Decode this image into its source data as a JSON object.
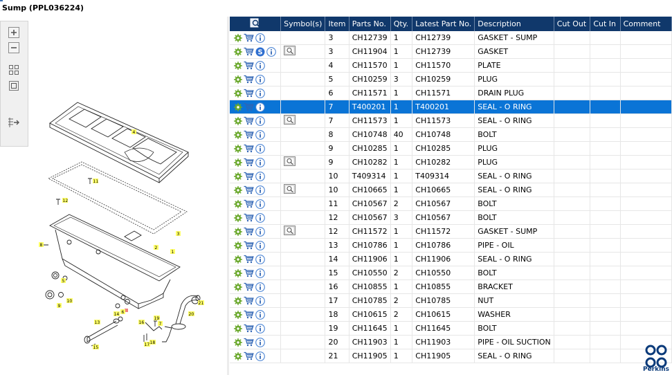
{
  "window": {
    "title": "Sump (PPL036224)"
  },
  "brand": {
    "name": "Perkins",
    "color": "#0a3a7a",
    "header_bg": "#10386b",
    "selected_bg": "#0a74d6"
  },
  "toolbar": {
    "buttons": [
      {
        "icon": "zoom-in-icon"
      },
      {
        "icon": "zoom-out-icon"
      },
      {
        "icon": "fit-all-icon"
      },
      {
        "icon": "fit-window-icon"
      },
      {
        "icon": "export-icon"
      }
    ]
  },
  "drawing": {
    "callouts": [
      "4",
      "11",
      "12",
      "2",
      "3",
      "1",
      "8",
      "5",
      "6",
      "9",
      "10",
      "14",
      "13",
      "16",
      "19",
      "7",
      "17",
      "18",
      "15",
      "20",
      "21"
    ]
  },
  "table": {
    "columns": [
      "",
      "Symbol(s)",
      "Item",
      "Parts No.",
      "Qty.",
      "Latest Part No.",
      "Description",
      "Cut Out",
      "Cut In",
      "Comment"
    ],
    "rows": [
      {
        "item": "3",
        "part": "CH12739",
        "qty": "1",
        "latest": "CH12739",
        "desc": "GASKET - SUMP",
        "s_icon": false,
        "sym": false,
        "selected": false
      },
      {
        "item": "3",
        "part": "CH11904",
        "qty": "1",
        "latest": "CH12739",
        "desc": "GASKET",
        "s_icon": true,
        "sym": true,
        "selected": false
      },
      {
        "item": "4",
        "part": "CH11570",
        "qty": "1",
        "latest": "CH11570",
        "desc": "PLATE",
        "s_icon": false,
        "sym": false,
        "selected": false
      },
      {
        "item": "5",
        "part": "CH10259",
        "qty": "3",
        "latest": "CH10259",
        "desc": "PLUG",
        "s_icon": false,
        "sym": false,
        "selected": false
      },
      {
        "item": "6",
        "part": "CH11571",
        "qty": "1",
        "latest": "CH11571",
        "desc": "DRAIN PLUG",
        "s_icon": false,
        "sym": false,
        "selected": false
      },
      {
        "item": "7",
        "part": "T400201",
        "qty": "1",
        "latest": "T400201",
        "desc": "SEAL - O RING",
        "s_icon": false,
        "sym": false,
        "selected": true
      },
      {
        "item": "7",
        "part": "CH11573",
        "qty": "1",
        "latest": "CH11573",
        "desc": "SEAL - O RING",
        "s_icon": false,
        "sym": true,
        "selected": false
      },
      {
        "item": "8",
        "part": "CH10748",
        "qty": "40",
        "latest": "CH10748",
        "desc": "BOLT",
        "s_icon": false,
        "sym": false,
        "selected": false
      },
      {
        "item": "9",
        "part": "CH10285",
        "qty": "1",
        "latest": "CH10285",
        "desc": "PLUG",
        "s_icon": false,
        "sym": false,
        "selected": false
      },
      {
        "item": "9",
        "part": "CH10282",
        "qty": "1",
        "latest": "CH10282",
        "desc": "PLUG",
        "s_icon": false,
        "sym": true,
        "selected": false
      },
      {
        "item": "10",
        "part": "T409314",
        "qty": "1",
        "latest": "T409314",
        "desc": "SEAL - O RING",
        "s_icon": false,
        "sym": false,
        "selected": false
      },
      {
        "item": "10",
        "part": "CH10665",
        "qty": "1",
        "latest": "CH10665",
        "desc": "SEAL - O RING",
        "s_icon": false,
        "sym": true,
        "selected": false
      },
      {
        "item": "11",
        "part": "CH10567",
        "qty": "2",
        "latest": "CH10567",
        "desc": "BOLT",
        "s_icon": false,
        "sym": false,
        "selected": false
      },
      {
        "item": "12",
        "part": "CH10567",
        "qty": "3",
        "latest": "CH10567",
        "desc": "BOLT",
        "s_icon": false,
        "sym": false,
        "selected": false
      },
      {
        "item": "12",
        "part": "CH11572",
        "qty": "1",
        "latest": "CH11572",
        "desc": "GASKET - SUMP",
        "s_icon": false,
        "sym": true,
        "selected": false
      },
      {
        "item": "13",
        "part": "CH10786",
        "qty": "1",
        "latest": "CH10786",
        "desc": "PIPE - OIL",
        "s_icon": false,
        "sym": false,
        "selected": false
      },
      {
        "item": "14",
        "part": "CH11906",
        "qty": "1",
        "latest": "CH11906",
        "desc": "SEAL - O RING",
        "s_icon": false,
        "sym": false,
        "selected": false
      },
      {
        "item": "15",
        "part": "CH10550",
        "qty": "2",
        "latest": "CH10550",
        "desc": "BOLT",
        "s_icon": false,
        "sym": false,
        "selected": false
      },
      {
        "item": "16",
        "part": "CH10855",
        "qty": "1",
        "latest": "CH10855",
        "desc": "BRACKET",
        "s_icon": false,
        "sym": false,
        "selected": false
      },
      {
        "item": "17",
        "part": "CH10785",
        "qty": "2",
        "latest": "CH10785",
        "desc": "NUT",
        "s_icon": false,
        "sym": false,
        "selected": false
      },
      {
        "item": "18",
        "part": "CH10615",
        "qty": "2",
        "latest": "CH10615",
        "desc": "WASHER",
        "s_icon": false,
        "sym": false,
        "selected": false
      },
      {
        "item": "19",
        "part": "CH11645",
        "qty": "1",
        "latest": "CH11645",
        "desc": "BOLT",
        "s_icon": false,
        "sym": false,
        "selected": false
      },
      {
        "item": "20",
        "part": "CH11903",
        "qty": "1",
        "latest": "CH11903",
        "desc": "PIPE - OIL SUCTION",
        "s_icon": false,
        "sym": false,
        "selected": false
      },
      {
        "item": "21",
        "part": "CH11905",
        "qty": "1",
        "latest": "CH11905",
        "desc": "SEAL - O RING",
        "s_icon": false,
        "sym": false,
        "selected": false
      }
    ]
  }
}
